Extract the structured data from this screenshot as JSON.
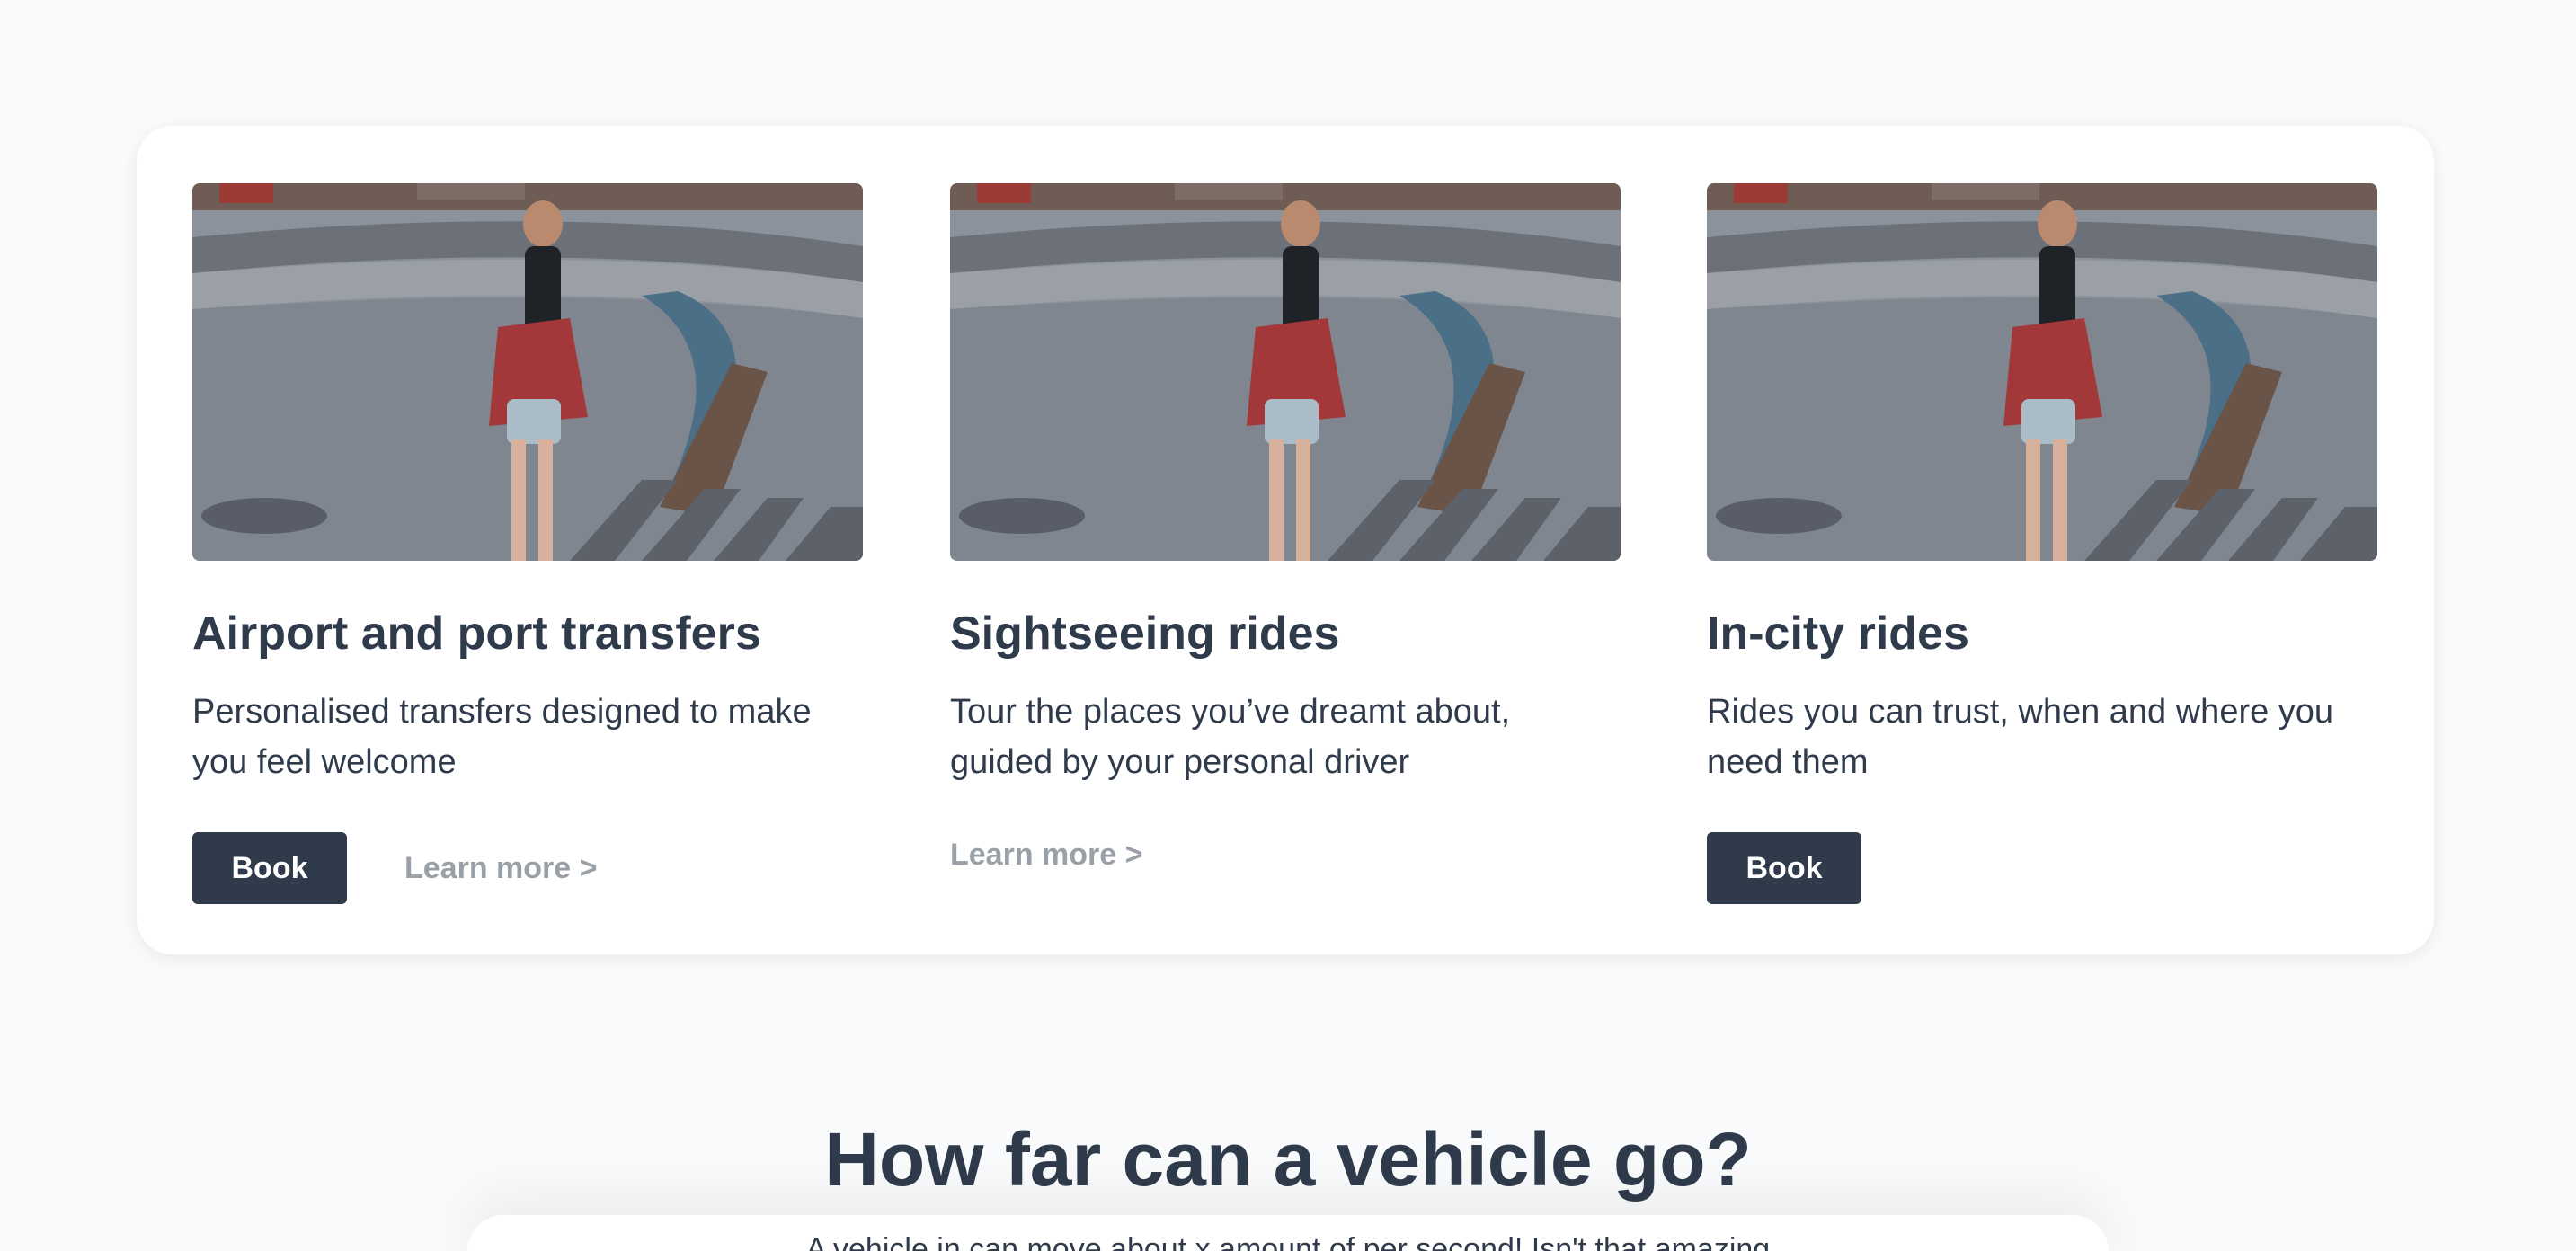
{
  "services": [
    {
      "title": "Airport and port transfers",
      "description": "Personalised transfers designed to make you feel welcome",
      "book_label": "Book",
      "learn_more_label": "Learn more >"
    },
    {
      "title": "Sightseeing rides",
      "description": "Tour the places you’ve dreamt about, guided by your personal driver",
      "learn_more_label": "Learn more >"
    },
    {
      "title": "In-city rides",
      "description": "Rides you can trust, when and where you need them",
      "book_label": "Book"
    }
  ],
  "section2": {
    "title": "How far can a vehicle go?",
    "subtitle": "A vehicle in can move about x amount of per second! Isn't that amazing"
  },
  "colors": {
    "primary": "#2f3a4b",
    "muted": "#9aa0a8",
    "background": "#f9fafb",
    "card": "#ffffff"
  }
}
